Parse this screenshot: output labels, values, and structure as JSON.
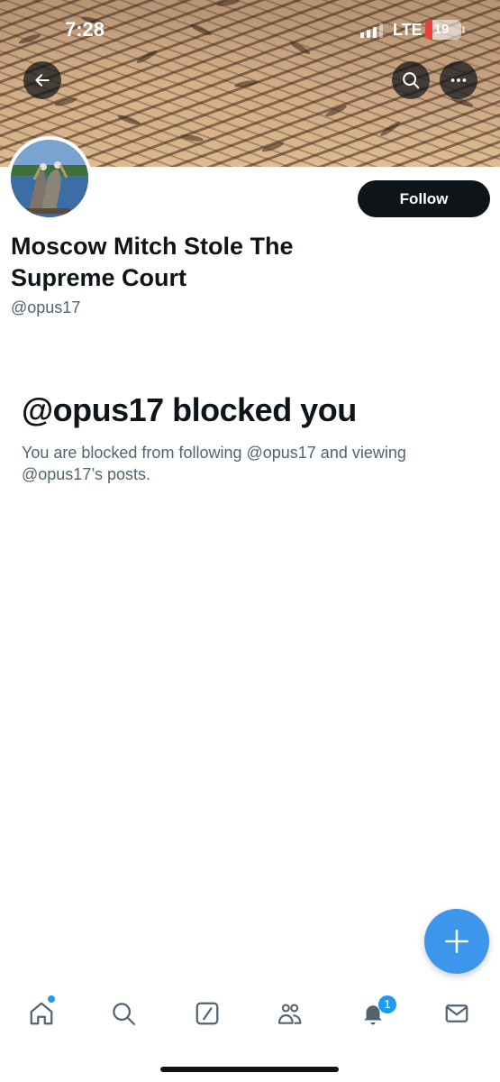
{
  "status_bar": {
    "time": "7:28",
    "network": "LTE",
    "battery": "19",
    "battery_level": 0.19
  },
  "profile": {
    "display_name": "Moscow Mitch Stole The Supreme Court",
    "handle": "@opus17",
    "follow_label": "Follow"
  },
  "blocked": {
    "title": "@opus17 blocked you",
    "description": "You are blocked from following @opus17 and viewing @opus17’s posts."
  },
  "bottom_nav": {
    "items": [
      "home-icon",
      "search-icon",
      "grok-icon",
      "communities-icon",
      "bell-icon",
      "mail-icon"
    ],
    "notification_count": "1"
  },
  "colors": {
    "accent": "#1d9bf0",
    "fab": "#3b96ec",
    "text": "#0f1419",
    "muted": "#536471"
  }
}
